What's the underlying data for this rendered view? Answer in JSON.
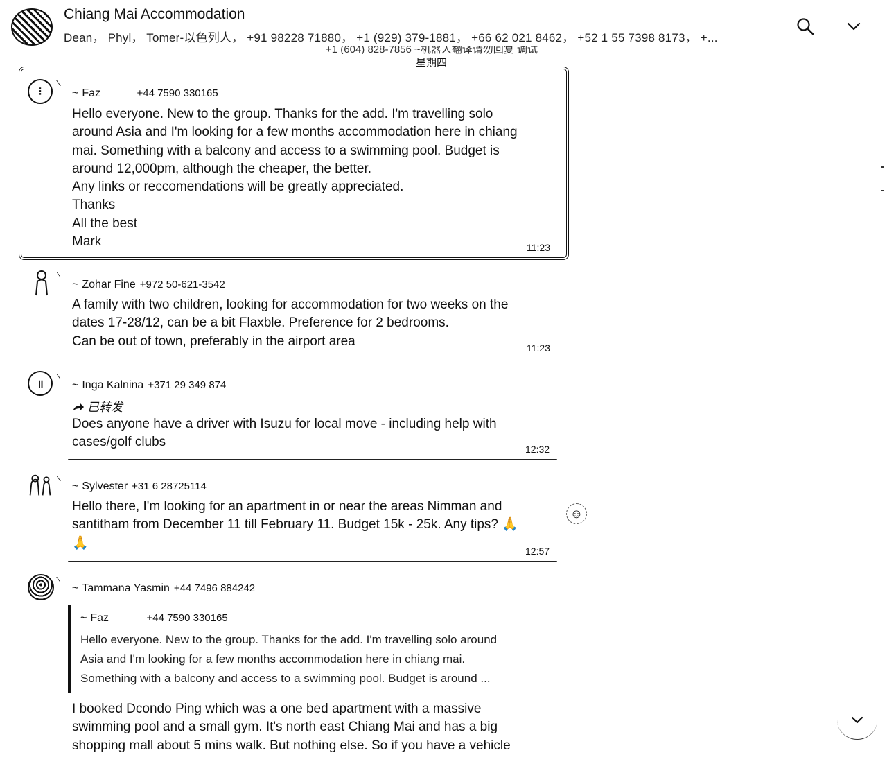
{
  "header": {
    "title": "Chiang Mai Accommodation",
    "members": "Dean， Phyl， Tomer-以色列人， +91 98228 71880， +1 (929) 379-1881， +66 62 021 8462， +52 1 55 7398 8173， +...",
    "icons": {
      "search": "search-icon",
      "menu": "chevron-down-icon"
    }
  },
  "date_divider": {
    "partial_above": "+1 (604) 828-7856  ~机器人翻译请勿回复 调试",
    "label": "星期四"
  },
  "messages": [
    {
      "sender": "Faz",
      "phone": "+44 7590 330165",
      "lines": [
        "Hello everyone. New to the group. Thanks for the add. I'm travelling solo",
        "around Asia and I'm looking for a few months accommodation here in chiang",
        "mai. Something with a balcony and access to a swimming pool. Budget is",
        "around 12,000pm, although the cheaper, the better.",
        "Any links or reccomendations will be greatly appreciated.",
        "Thanks",
        "All the best",
        "Mark"
      ],
      "time": "11:23"
    },
    {
      "sender": "Zohar Fine",
      "phone": "+972 50-621-3542",
      "lines": [
        "A family with two children, looking for accommodation for two weeks on the",
        "dates 17-28/12, can be a bit Flaxble. Preference for 2 bedrooms.",
        "Can be out of town, preferably in the airport area"
      ],
      "time": "11:23"
    },
    {
      "sender": "Inga Kalnina",
      "phone": "+371 29 349 874",
      "forwarded": "已转发",
      "lines": [
        "Does anyone have a driver with Isuzu for local move - including help with",
        "cases/golf clubs"
      ],
      "time": "12:32"
    },
    {
      "sender": "Sylvester",
      "phone": "+31 6 28725114",
      "lines": [
        "Hello there, I'm looking for an apartment in or near the areas Nimman and",
        "santitham from December 11 till February 11. Budget 15k - 25k. Any tips? 🙏",
        "🙏"
      ],
      "time": "12:57"
    },
    {
      "sender": "Tammana Yasmin",
      "phone": "+44 7496 884242",
      "quote": {
        "sender": "Faz",
        "phone": "+44 7590 330165",
        "lines": [
          "Hello everyone. New to the group. Thanks for the add. I'm travelling solo around",
          "Asia and I'm looking for a few months accommodation here in chiang mai.",
          "Something with a balcony and access to a swimming pool. Budget is around ..."
        ]
      },
      "lines": [
        "I booked Dcondo Ping which was a one bed apartment with a massive",
        "swimming pool and a small gym. It's north east Chiang Mai and has a big",
        "shopping mall about 5 mins walk. But nothing else. So if you have a vehicle"
      ]
    }
  ],
  "tilde": "~",
  "icons": {
    "forward": "forward-arrow-icon",
    "react": "emoji-react-icon",
    "scroll_down": "scroll-down-icon"
  }
}
